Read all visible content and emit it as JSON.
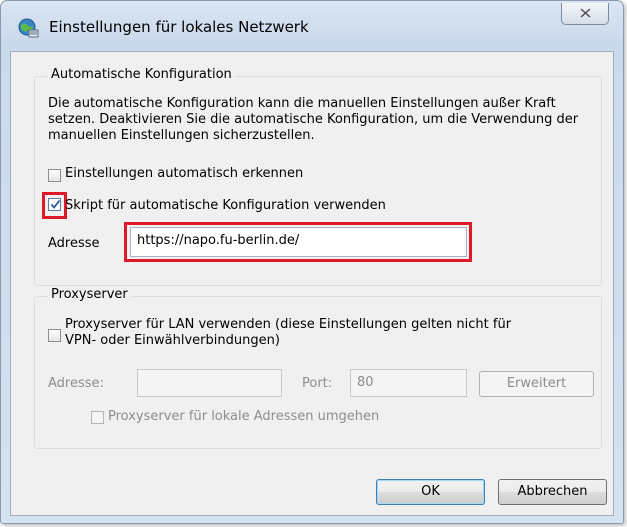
{
  "window": {
    "title": "Einstellungen für lokales Netzwerk",
    "icon": "network-globe-icon",
    "close_icon": "close-x-icon"
  },
  "auto_config": {
    "group_title": "Automatische Konfiguration",
    "description": "Die automatische Konfiguration kann die manuellen Einstellungen außer Kraft setzen. Deaktivieren Sie die automatische Konfiguration, um die Verwendung der manuellen Einstellungen sicherzustellen.",
    "detect_label": "Einstellungen automatisch erkennen",
    "detect_checked": false,
    "script_label": "Skript für automatische Konfiguration verwenden",
    "script_checked": true,
    "address_label": "Adresse",
    "address_value": "https://napo.fu-berlin.de/"
  },
  "proxy": {
    "group_title": "Proxyserver",
    "use_proxy_label_line1": "Proxyserver für LAN verwenden (diese Einstellungen gelten nicht für",
    "use_proxy_label_line2": "VPN- oder Einwählverbindungen)",
    "use_proxy_checked": false,
    "address_label": "Adresse:",
    "address_value": "",
    "port_label": "Port:",
    "port_value": "80",
    "advanced_label": "Erweitert",
    "bypass_label": "Proxyserver für lokale Adressen umgehen",
    "bypass_checked": false
  },
  "buttons": {
    "ok": "OK",
    "cancel": "Abbrechen"
  },
  "colors": {
    "highlight": "#e0192a",
    "title_gradient": "#cad9ec",
    "client_bg": "#f0f0f0"
  }
}
